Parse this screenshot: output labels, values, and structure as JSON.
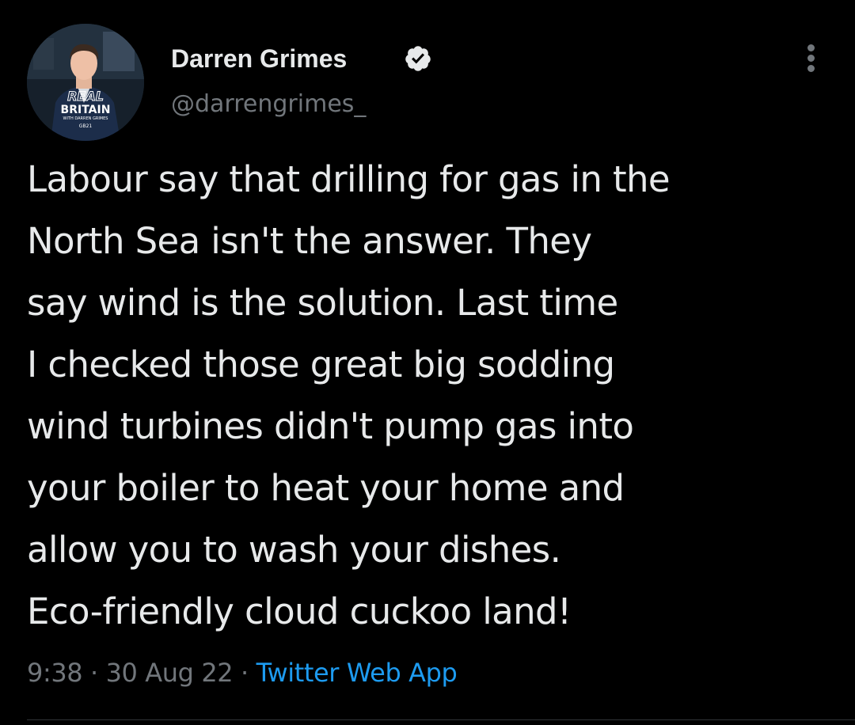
{
  "colors": {
    "background": "#000000",
    "text_primary": "#e7e9ea",
    "text_secondary": "#71767b",
    "accent": "#1d9bf0",
    "divider": "#2f3336"
  },
  "author": {
    "display_name": "Darren Grimes",
    "handle": "@darrengrimes_",
    "verified_icon": "verified-badge-icon",
    "avatar_text": {
      "line1": "REAL",
      "line2": "BRITAIN",
      "line3": "WITH DARREN GRIMES",
      "line4": "GB21"
    }
  },
  "menu": {
    "icon": "more-vertical-icon"
  },
  "tweet": {
    "lines": [
      "Labour say that drilling for gas in the",
      "North Sea isn't the answer. They",
      "say wind is the solution. Last time",
      "I checked those great big sodding",
      "wind turbines didn't pump gas into",
      "your boiler to heat your home and",
      "allow you to wash your dishes.",
      "Eco-friendly cloud cuckoo land!"
    ]
  },
  "meta": {
    "time": "9:38",
    "separator": " · ",
    "date": "30 Aug 22",
    "source": "Twitter Web App"
  }
}
